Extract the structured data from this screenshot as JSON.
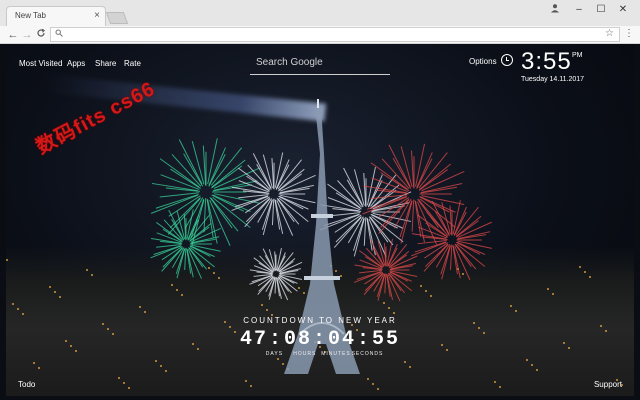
{
  "browser": {
    "tab_title": "New Tab",
    "tab_close": "×",
    "window_controls": {
      "minimize": "–",
      "maximize": "☐",
      "close": "✕"
    },
    "nav": {
      "back": "←",
      "forward": "→",
      "reload": "C"
    },
    "omnibox": {
      "value": "",
      "placeholder": ""
    },
    "icons": {
      "profile": "profile-icon",
      "search": "search-icon",
      "star": "star-icon",
      "menu": "menu-dots-icon"
    }
  },
  "newtab": {
    "nav_links": [
      "Most Visited",
      "Apps",
      "Share",
      "Rate"
    ],
    "search": {
      "placeholder": "Search Google",
      "value": ""
    },
    "options_label": "Options",
    "clock": {
      "time": "3:55",
      "ampm": "PM",
      "date": "Tuesday  14.11.2017"
    },
    "countdown": {
      "title": "COUNTDOWN TO NEW YEAR",
      "days": "47",
      "hours": "08",
      "minutes": "04",
      "seconds": "55",
      "separator": ":",
      "labels": [
        "DAYS",
        "HOURS",
        "MINUTES",
        "SECONDS"
      ]
    },
    "bottom_left": "Todo",
    "bottom_right": "Support",
    "watermark": "数码fits cs66"
  },
  "colors": {
    "firework_green": "#39d59a",
    "firework_red": "#e04a4a",
    "firework_white": "#e8ecf4",
    "city_light": "#ffb640",
    "watermark": "#d41818"
  }
}
